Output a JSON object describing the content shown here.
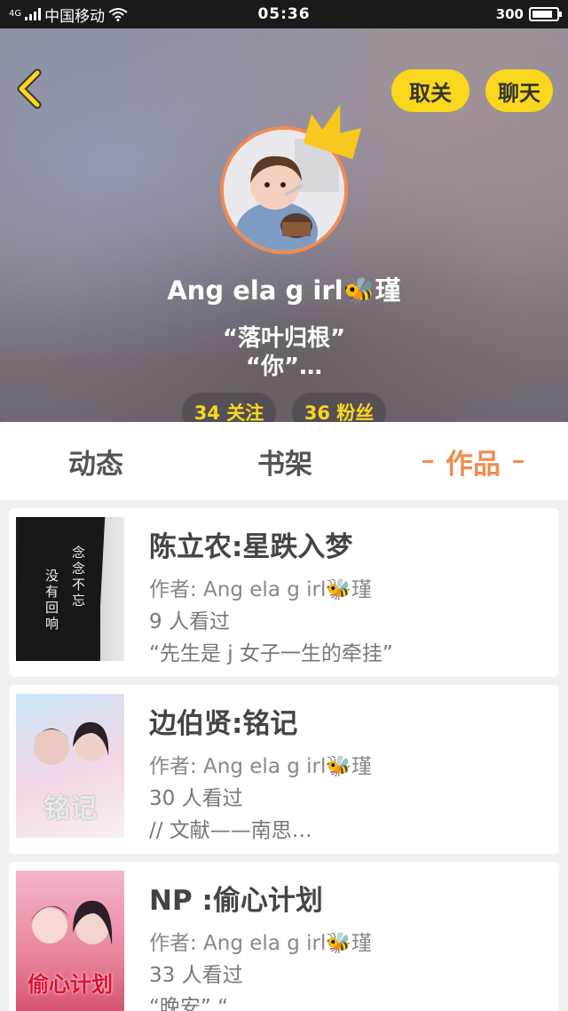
{
  "status_bar": {
    "carrier": "中国移动",
    "network": "4G",
    "time": "05:36",
    "speed": "300"
  },
  "header": {
    "unfollow_label": "取关",
    "chat_label": "聊天",
    "username": "Ang ela g irl🐝瑾",
    "bio_line1": "“落叶归根”",
    "bio_line2": "“你”…",
    "follow_stat": "34 关注",
    "fans_stat": "36 粉丝"
  },
  "tabs": [
    {
      "label": "动态"
    },
    {
      "label": "书架"
    },
    {
      "label": "作品",
      "active": true
    }
  ],
  "works": [
    {
      "title": "陈立农:星跌入梦",
      "author": "作者: Ang ela g irl🐝瑾",
      "views": "9 人看过",
      "desc": "“先生是 j 女子一生的牵挂”",
      "cover_text": [
        "念",
        "念",
        "不",
        "忘",
        "没",
        "有",
        "回",
        "响"
      ]
    },
    {
      "title": "边伯贤:铭记",
      "author": "作者: Ang ela g irl🐝瑾",
      "views": "30 人看过",
      "desc": "// 文献——南思…",
      "cover_text": [
        "铭记"
      ]
    },
    {
      "title": "NP :偷心计划",
      "author": "作者: Ang ela g irl🐝瑾",
      "views": "33 人看过",
      "desc": "“晚安”  “…",
      "cover_text": [
        "偷心计划"
      ]
    }
  ],
  "colors": {
    "accent": "#f08c4c",
    "yellow": "#f9d71c",
    "battery_level": 0.85
  }
}
